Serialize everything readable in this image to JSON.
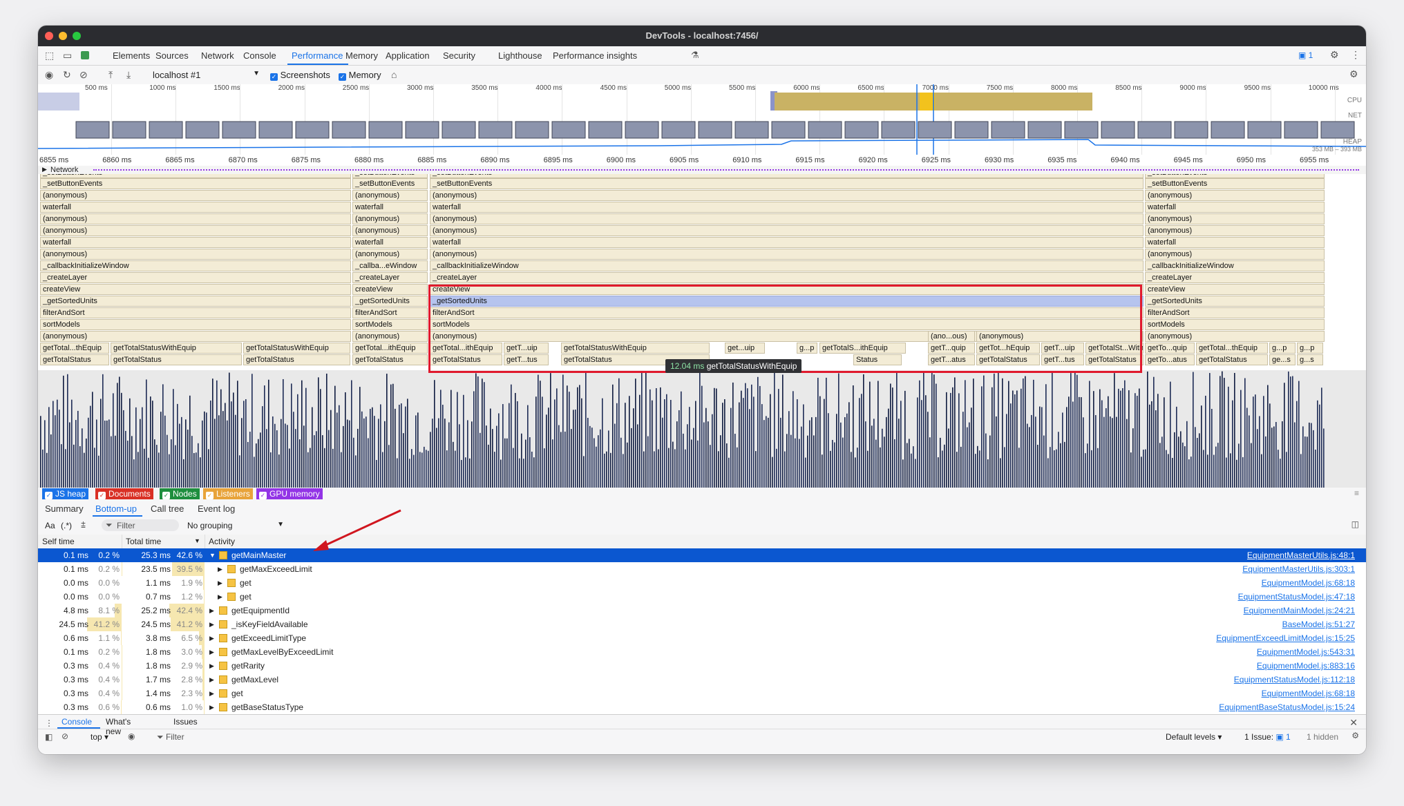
{
  "window": {
    "title": "DevTools - localhost:7456/"
  },
  "tabs": [
    "Elements",
    "Sources",
    "Network",
    "Console",
    "Performance",
    "Memory",
    "Application",
    "Security",
    "Lighthouse",
    "Performance insights"
  ],
  "active_tab": "Performance",
  "issues_badge": "1",
  "toolbar": {
    "profile": "localhost #1",
    "screenshots_label": "Screenshots",
    "memory_label": "Memory"
  },
  "overview": {
    "ticks": [
      "500 ms",
      "1000 ms",
      "1500 ms",
      "2000 ms",
      "2500 ms",
      "3000 ms",
      "3500 ms",
      "4000 ms",
      "4500 ms",
      "5000 ms",
      "5500 ms",
      "6000 ms",
      "6500 ms",
      "7000 ms",
      "7500 ms",
      "8000 ms",
      "8500 ms",
      "9000 ms",
      "9500 ms",
      "10000 ms"
    ],
    "cpu_label": "CPU",
    "net_label": "NET",
    "heap_label": "HEAP",
    "heap_range": "353 MB – 393 MB"
  },
  "ruler": [
    "6855 ms",
    "6860 ms",
    "6865 ms",
    "6870 ms",
    "6875 ms",
    "6880 ms",
    "6885 ms",
    "6890 ms",
    "6895 ms",
    "6900 ms",
    "6905 ms",
    "6910 ms",
    "6915 ms",
    "6920 ms",
    "6925 ms",
    "6930 ms",
    "6935 ms",
    "6940 ms",
    "6945 ms",
    "6950 ms",
    "6955 ms"
  ],
  "network_label": "Network",
  "flame_stack": [
    "_setButtonEvents",
    "(anonymous)",
    "waterfall",
    "(anonymous)",
    "(anonymous)",
    "waterfall",
    "(anonymous)",
    "_callbackInitializeWindow",
    "_createLayer",
    "createView",
    "_getSortedUnits",
    "filterAndSort",
    "sortModels",
    "(anonymous)"
  ],
  "flame_stack_short": [
    "_setButtonEvents",
    "(anonymous)",
    "waterfall",
    "(anonymous)",
    "(anonymous)",
    "waterfall",
    "(anonymous)",
    "_callba...eWindow",
    "_createLayer",
    "createView",
    "_getSortedUnits",
    "filterAndSort",
    "sortModels",
    "(anonymous)"
  ],
  "flame_top_label": "_setButtonEvents",
  "flame_leaves": {
    "a1": "getTotal...thEquip",
    "a2": "getTotalStatusWithEquip",
    "a3": "getTotalStatusWithEquip",
    "a4": "getTotalStatus",
    "a5": "getTotalStatus",
    "a6": "getTotalStatus",
    "b1": "getTotal...ithEquip",
    "b2": "getTotalStatus",
    "c1": "getTotal...ithEquip",
    "c2": "getT...uip",
    "c3": "getTotalStatusWithEquip",
    "c4": "get...uip",
    "c5": "g...p",
    "c6": "getTotalS...ithEquip",
    "c7": "getTotalStatus",
    "c8": "getT...tus",
    "c9": "getTotalStatus",
    "c10": "Status",
    "d0": "(ano...ous)",
    "d00": "(anonymous)",
    "d1": "getT...quip",
    "d2": "getTot...hEquip",
    "d3": "getT...uip",
    "d4": "getTotalSt...WithEquip",
    "d5": "getT...atus",
    "d6": "getTotalStatus",
    "d7": "getT...tus",
    "d8": "getTotalStatus",
    "e1": "getTo...quip",
    "e2": "getTotal...thEquip",
    "e3": "g...p",
    "e4": "g...p",
    "e5": "getTo...atus",
    "e6": "getTotalStatus",
    "e7": "ge...s",
    "e8": "g...s"
  },
  "tooltip": {
    "time": "12.04 ms",
    "name": "getTotalStatusWithEquip"
  },
  "legend": [
    {
      "label": "JS heap",
      "color": "#1a73e8"
    },
    {
      "label": "Documents",
      "color": "#d93025"
    },
    {
      "label": "Nodes",
      "color": "#1e8e3e"
    },
    {
      "label": "Listeners",
      "color": "#e8a33a"
    },
    {
      "label": "GPU memory",
      "color": "#9334e6"
    }
  ],
  "subtabs": [
    "Summary",
    "Bottom-up",
    "Call tree",
    "Event log"
  ],
  "active_subtab": "Bottom-up",
  "filter": {
    "case_label": "Aa",
    "regex_label": "(.*)",
    "placeholder": "Filter",
    "grouping": "No grouping"
  },
  "columns": {
    "self": "Self time",
    "total": "Total time",
    "activity": "Activity"
  },
  "rows": [
    {
      "self": "0.1 ms",
      "self_pct": "0.2 %",
      "total": "25.3 ms",
      "total_pct": "42.6 %",
      "name": "getMainMaster",
      "link": "EquipmentMasterUtils.js:48:1",
      "level": 0,
      "expanded": true,
      "selected": true
    },
    {
      "self": "0.1 ms",
      "self_pct": "0.2 %",
      "total": "23.5 ms",
      "total_pct": "39.5 %",
      "name": "getMaxExceedLimit",
      "link": "EquipmentMasterUtils.js:303:1",
      "level": 1
    },
    {
      "self": "0.0 ms",
      "self_pct": "0.0 %",
      "total": "1.1 ms",
      "total_pct": "1.9 %",
      "name": "get",
      "link": "EquipmentModel.js:68:18",
      "level": 1
    },
    {
      "self": "0.0 ms",
      "self_pct": "0.0 %",
      "total": "0.7 ms",
      "total_pct": "1.2 %",
      "name": "get",
      "link": "EquipmentStatusModel.js:47:18",
      "level": 1
    },
    {
      "self": "4.8 ms",
      "self_pct": "8.1 %",
      "total": "25.2 ms",
      "total_pct": "42.4 %",
      "name": "getEquipmentId",
      "link": "EquipmentMainModel.js:24:21",
      "level": 0
    },
    {
      "self": "24.5 ms",
      "self_pct": "41.2 %",
      "total": "24.5 ms",
      "total_pct": "41.2 %",
      "name": "_isKeyFieldAvailable",
      "link": "BaseModel.js:51:27",
      "level": 0
    },
    {
      "self": "0.6 ms",
      "self_pct": "1.1 %",
      "total": "3.8 ms",
      "total_pct": "6.5 %",
      "name": "getExceedLimitType",
      "link": "EquipmentExceedLimitModel.js:15:25",
      "level": 0
    },
    {
      "self": "0.1 ms",
      "self_pct": "0.2 %",
      "total": "1.8 ms",
      "total_pct": "3.0 %",
      "name": "getMaxLevelByExceedLimit",
      "link": "EquipmentModel.js:543:31",
      "level": 0
    },
    {
      "self": "0.3 ms",
      "self_pct": "0.4 %",
      "total": "1.8 ms",
      "total_pct": "2.9 %",
      "name": "getRarity",
      "link": "EquipmentModel.js:883:16",
      "level": 0
    },
    {
      "self": "0.3 ms",
      "self_pct": "0.4 %",
      "total": "1.7 ms",
      "total_pct": "2.8 %",
      "name": "getMaxLevel",
      "link": "EquipmentStatusModel.js:112:18",
      "level": 0
    },
    {
      "self": "0.3 ms",
      "self_pct": "0.4 %",
      "total": "1.4 ms",
      "total_pct": "2.3 %",
      "name": "get",
      "link": "EquipmentModel.js:68:18",
      "level": 0
    },
    {
      "self": "0.3 ms",
      "self_pct": "0.6 %",
      "total": "0.6 ms",
      "total_pct": "1.0 %",
      "name": "getBaseStatusType",
      "link": "EquipmentBaseStatusModel.js:15:24",
      "level": 0
    }
  ],
  "drawer": {
    "tabs": [
      "Console",
      "What's new",
      "Issues"
    ],
    "active": "Console",
    "context": "top",
    "filter_placeholder": "Filter",
    "levels": "Default levels",
    "issues": "1 Issue:",
    "issues_count": "1",
    "hidden": "1 hidden"
  }
}
